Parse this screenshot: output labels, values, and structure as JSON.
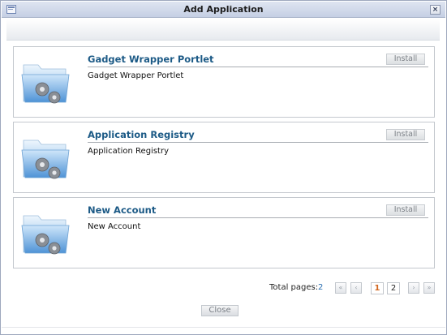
{
  "dialog": {
    "title": "Add Application",
    "close_glyph": "×",
    "title_icon": "window-icon",
    "close_icon": "close-icon"
  },
  "apps": [
    {
      "name": "Gadget Wrapper Portlet",
      "description": "Gadget Wrapper Portlet",
      "install_label": "Install",
      "icon": "folder-gears-icon"
    },
    {
      "name": "Application Registry",
      "description": "Application Registry",
      "install_label": "Install",
      "icon": "folder-gears-icon"
    },
    {
      "name": "New Account",
      "description": "New Account",
      "install_label": "Install",
      "icon": "folder-gears-icon"
    }
  ],
  "pagination": {
    "total_label": "Total pages:",
    "total_pages": "2",
    "first_glyph": "«",
    "prev_glyph": "‹",
    "next_glyph": "›",
    "last_glyph": "»",
    "pages": [
      "1",
      "2"
    ],
    "current_page": "1"
  },
  "footer": {
    "close_label": "Close"
  },
  "colors": {
    "app_name": "#1c5a86",
    "active_page": "#d2651d",
    "total_pages_number": "#2a6fb0",
    "titlebar": "#c5cfe4"
  }
}
